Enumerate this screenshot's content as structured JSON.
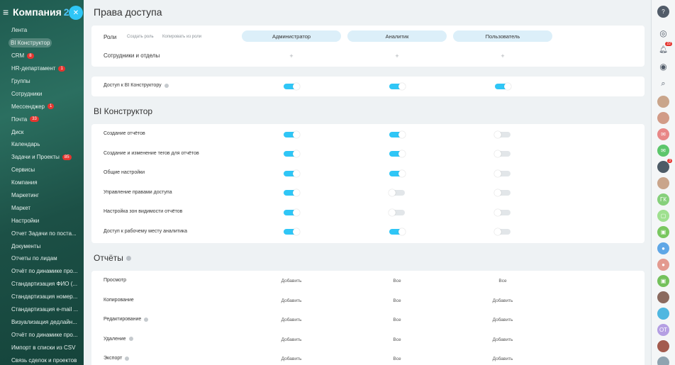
{
  "sidebar": {
    "logo": "Компания",
    "logo_num": "24",
    "items": [
      {
        "label": "Лента",
        "count": ""
      },
      {
        "label": "BI Конструктор",
        "count": "",
        "active": true
      },
      {
        "label": "CRM",
        "count": "8"
      },
      {
        "label": "HR-департамент",
        "count": "1"
      },
      {
        "label": "Группы",
        "count": ""
      },
      {
        "label": "Сотрудники",
        "count": ""
      },
      {
        "label": "Мессенджер",
        "count": "1"
      },
      {
        "label": "Почта",
        "count": "33"
      },
      {
        "label": "Диск",
        "count": ""
      },
      {
        "label": "Календарь",
        "count": ""
      },
      {
        "label": "Задачи и Проекты",
        "count": "85"
      },
      {
        "label": "Сервисы",
        "count": ""
      },
      {
        "label": "Компания",
        "count": ""
      },
      {
        "label": "Маркетинг",
        "count": ""
      },
      {
        "label": "Маркет",
        "count": ""
      },
      {
        "label": "Настройки",
        "count": ""
      },
      {
        "label": "Отчет Задачи по поста...",
        "count": ""
      },
      {
        "label": "Документы",
        "count": ""
      },
      {
        "label": "Отчеты по лидам",
        "count": ""
      },
      {
        "label": "Отчёт по динамике про...",
        "count": ""
      },
      {
        "label": "Стандартизация ФИО (...",
        "count": ""
      },
      {
        "label": "Стандартизация номер...",
        "count": ""
      },
      {
        "label": "Стандартизация e-mail ...",
        "count": ""
      },
      {
        "label": "Визуализация дедлайн...",
        "count": ""
      },
      {
        "label": "Отчёт по динамике про...",
        "count": ""
      },
      {
        "label": "Импорт в списки из CSV",
        "count": ""
      },
      {
        "label": "Связь сделок и проектов",
        "count": ""
      }
    ]
  },
  "rightbar": {
    "notifications_count": "22",
    "avatar_initials_1": "ГК",
    "avatar_initials_2": "ОТ",
    "avatar_badge": "3"
  },
  "page": {
    "title": "Права доступа",
    "roles_label": "Роли",
    "create_role": "Создать роль",
    "copy_from_role": "Копировать из роли",
    "roles": [
      "Администратор",
      "Аналитик",
      "Пользователь"
    ],
    "employees_label": "Сотрудники и отделы",
    "plus": "+"
  },
  "access": {
    "label": "Доступ к BI Конструктору",
    "values": [
      true,
      true,
      true
    ]
  },
  "bi_section": {
    "title": "BI Конструктор",
    "rows": [
      {
        "label": "Создание отчётов",
        "values": [
          true,
          true,
          false
        ]
      },
      {
        "label": "Создание и изменение тегов для отчётов",
        "values": [
          true,
          true,
          false
        ]
      },
      {
        "label": "Общие настройки",
        "values": [
          true,
          true,
          false
        ]
      },
      {
        "label": "Управление правами доступа",
        "values": [
          true,
          false,
          false
        ]
      },
      {
        "label": "Настройка зон видимости отчётов",
        "values": [
          true,
          false,
          false
        ]
      },
      {
        "label": "Доступ к рабочему месту аналитика",
        "values": [
          true,
          true,
          false
        ]
      }
    ]
  },
  "reports_section": {
    "title": "Отчёты",
    "rows": [
      {
        "label": "Просмотр",
        "values": [
          "Добавить",
          "Все",
          "Все"
        ],
        "help": false
      },
      {
        "label": "Копирование",
        "values": [
          "Добавить",
          "Все",
          "Добавить"
        ],
        "help": false
      },
      {
        "label": "Редактирование",
        "values": [
          "Добавить",
          "Все",
          "Добавить"
        ],
        "help": true
      },
      {
        "label": "Удаление",
        "values": [
          "Добавить",
          "Все",
          "Добавить"
        ],
        "help": true
      },
      {
        "label": "Экспорт",
        "values": [
          "Добавить",
          "Все",
          "Добавить"
        ],
        "help": true
      }
    ]
  },
  "colors": {
    "accent": "#2fc6f6",
    "pill": "#dceff9",
    "sidebar": "#1f5b50",
    "badge": "#e5352f"
  }
}
